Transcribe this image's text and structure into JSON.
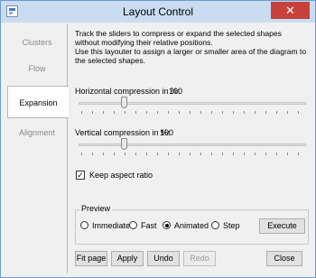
{
  "window": {
    "title": "Layout Control",
    "close_glyph": "✕"
  },
  "sidebar": {
    "items": [
      {
        "label": "Clusters"
      },
      {
        "label": "Flow"
      },
      {
        "label": "Expansion"
      },
      {
        "label": "Alignment"
      }
    ]
  },
  "description": {
    "line1": "Track the sliders to compress or expand the selected shapes without modifying their relative positions.",
    "line2": "Use this layouter to assign a larger or smaller area of the diagram to the selected shapes."
  },
  "horizontal": {
    "label": "Horizontal compression in %:",
    "value": "100"
  },
  "vertical": {
    "label": "Vertical compression in %:",
    "value": "100"
  },
  "aspect": {
    "label": "Keep aspect ratio",
    "checked": true
  },
  "preview": {
    "title": "Preview",
    "options": [
      "Immediate",
      "Fast",
      "Animated",
      "Step"
    ],
    "selected": "Animated"
  },
  "buttons": {
    "execute": "Execute",
    "fit_page": "Fit page",
    "apply": "Apply",
    "undo": "Undo",
    "redo": "Redo",
    "close": "Close"
  }
}
